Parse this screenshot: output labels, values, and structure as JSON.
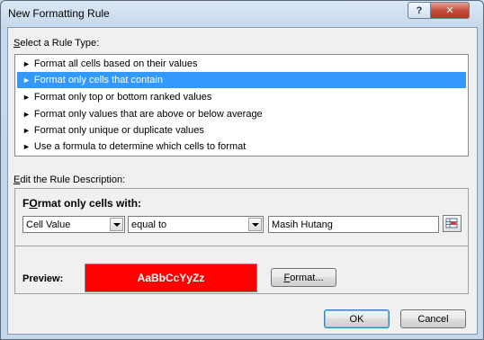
{
  "window": {
    "title": "New Formatting Rule",
    "help_label": "?",
    "close_label": "✕"
  },
  "rule_type": {
    "label_accel": "S",
    "label_rest": "elect a Rule Type:",
    "arrow": "►",
    "items": [
      {
        "label": "Format all cells based on their values"
      },
      {
        "label": "Format only cells that contain"
      },
      {
        "label": "Format only top or bottom ranked values"
      },
      {
        "label": "Format only values that are above or below average"
      },
      {
        "label": "Format only unique or duplicate values"
      },
      {
        "label": "Use a formula to determine which cells to format"
      }
    ],
    "selected_index": 1
  },
  "description": {
    "label_accel": "E",
    "label_rest": "dit the Rule Description:",
    "heading_accel": "O",
    "heading_pre": "F",
    "heading_rest": "rmat only cells with:",
    "cell_type": "Cell Value",
    "operator": "equal to",
    "value": "Masih Hutang",
    "preview_label": "Preview:",
    "preview_text": "AaBbCcYyZz",
    "preview_bg": "#ff0000",
    "format_accel": "F",
    "format_rest": "ormat..."
  },
  "buttons": {
    "ok": "OK",
    "cancel": "Cancel"
  }
}
